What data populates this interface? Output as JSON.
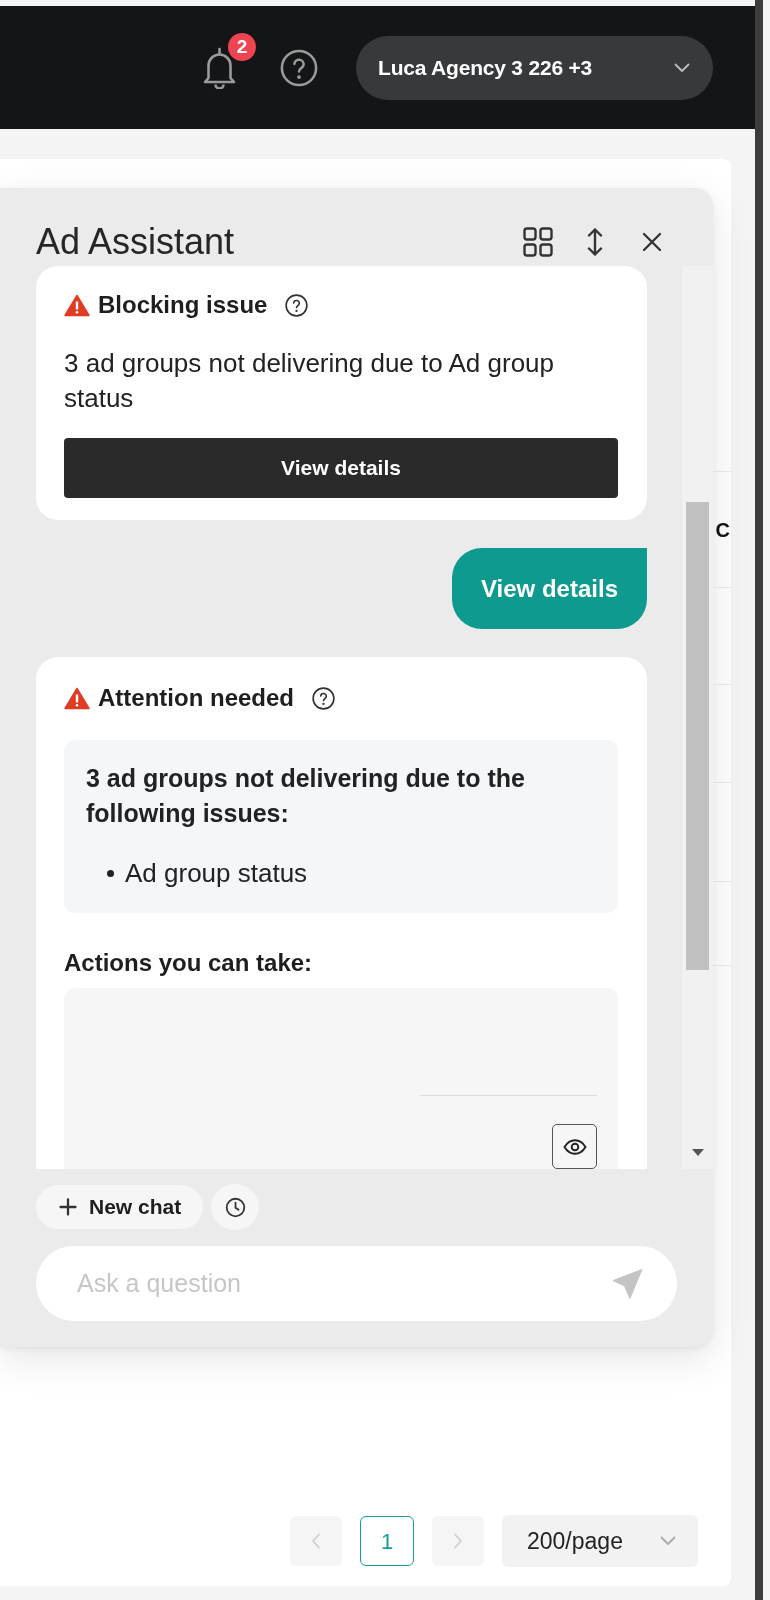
{
  "top_bar": {
    "notification_count": "2",
    "account": "Luca Agency 3 226 +3"
  },
  "background_table": {
    "header_cells": [
      "C"
    ]
  },
  "assistant": {
    "title": "Ad Assistant",
    "messages": [
      {
        "kind": "issue",
        "title": "Blocking issue",
        "text": "3 ad groups not delivering due to Ad group status",
        "button": "View details"
      },
      {
        "kind": "user",
        "text": "View details"
      },
      {
        "kind": "diagnosis",
        "title": "Attention needed",
        "summary": "3 ad groups not delivering due to the following issues:",
        "issues": [
          "Ad group status"
        ],
        "actions_heading": "Actions you can take:"
      }
    ],
    "new_chat_button": "New chat",
    "question_field": {
      "placeholder": "Ask a question"
    }
  },
  "pagination": {
    "previous": {
      "disabled": true
    },
    "pages": [
      {
        "label": "1",
        "selected": true
      }
    ],
    "next": {
      "disabled": true
    },
    "page_size": "200/page"
  }
}
